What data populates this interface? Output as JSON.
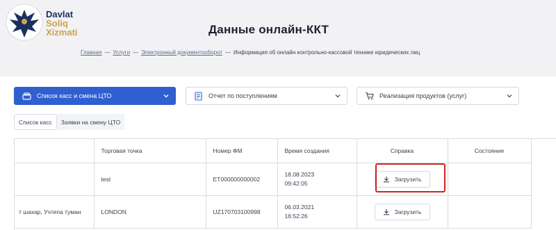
{
  "logo": {
    "line1": "Davlat",
    "line2": "Soliq",
    "line3": "Xizmati",
    "icon": "eagle-emblem-icon"
  },
  "page": {
    "title": "Данные онлайн-ККТ"
  },
  "breadcrumb": {
    "items": [
      "Главная",
      "Услуги",
      "Электронный документооборот"
    ],
    "separator": "—",
    "current": "Информация об онлайн контрольно-кассовой технике юридических лиц"
  },
  "filters": [
    {
      "label": "Список касс и смена ЦТО",
      "icon": "cash-register-icon",
      "active": true
    },
    {
      "label": "Отчет по поступлениям",
      "icon": "document-report-icon",
      "active": false
    },
    {
      "label": "Реализация продуктов (услуг)",
      "icon": "cart-icon",
      "active": false
    }
  ],
  "tabs": [
    {
      "label": "Список касс",
      "active": true
    },
    {
      "label": "Заявки на смену ЦТО",
      "active": false
    }
  ],
  "table": {
    "headers": [
      "",
      "Торговая точка",
      "Номер ФМ",
      "Время создания",
      "Справка",
      "Состояние"
    ],
    "rows": [
      {
        "address": "",
        "point": "test",
        "fm": "ET000000000002",
        "date": "18.08.2023",
        "time": "09:42:05",
        "action": "Загрузить",
        "state": ""
      },
      {
        "address": "т шахар, Учтепа туман",
        "point": "LONDON",
        "fm": "UZ170703100998",
        "date": "06.03.2021",
        "time": "16:52:26",
        "action": "Загрузить",
        "state": ""
      }
    ]
  },
  "colors": {
    "accent": "#2f5fd0",
    "highlight": "#d0231f",
    "brand_navy": "#1b2f5e",
    "brand_gold": "#c9a34f"
  }
}
